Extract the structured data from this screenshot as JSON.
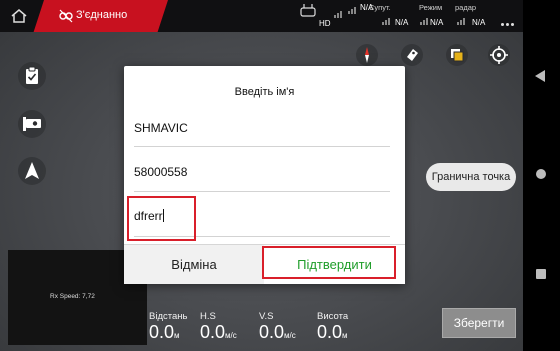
{
  "status_bar": {
    "connection": "З'єднанно",
    "hd_label": "HD",
    "telemetry": [
      {
        "label": "",
        "value": "N/A"
      },
      {
        "label": "Супут.",
        "value": "N/A"
      },
      {
        "label": "Режим",
        "value": "N/A"
      },
      {
        "label": "радар",
        "value": "N/A"
      }
    ]
  },
  "dialog": {
    "title": "Введіть ім'я",
    "field_name": "SHMAVIC",
    "field_number": "58000558",
    "field_input": "dfrerr",
    "cancel_label": "Відміна",
    "confirm_label": "Підтвердити"
  },
  "map_controls": {
    "boundary_point_label": "Гранична точка",
    "save_label": "Зберегти"
  },
  "camera": {
    "rx_speed": "Rx Speed: 7,72"
  },
  "stats": [
    {
      "label": "Відстань",
      "value": "0.0",
      "unit": "м"
    },
    {
      "label": "H.S",
      "value": "0.0",
      "unit": "м/с"
    },
    {
      "label": "V.S",
      "value": "0.0",
      "unit": "м/с"
    },
    {
      "label": "Висота",
      "value": "0.0",
      "unit": "м"
    }
  ],
  "colors": {
    "connection_bg": "#c8111f",
    "highlight": "#d91f2a",
    "confirm_text": "#1f9d2a"
  }
}
